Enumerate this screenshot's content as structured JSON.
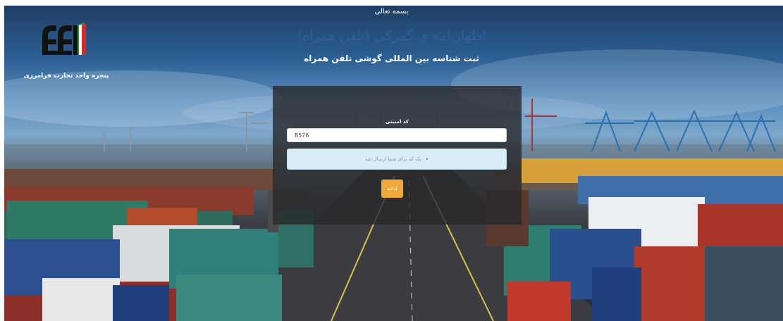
{
  "header": {
    "invocation": "بسمه تعالی",
    "title": "اظهارنامه ی گمرکی (تلفن همراه)",
    "subtitle": "ثبت شناسه بین المللی گوشی تلفن همراه"
  },
  "logo": {
    "icon": "customs-logo-icon",
    "caption": "پنجره واحد تجارت فرامرزی"
  },
  "form": {
    "label": "کد امنیتی",
    "code_value": "8576",
    "info_message": "یک کد برای شما ارسال شد",
    "continue_label": "ادامه"
  },
  "colors": {
    "accent": "#f0a83a",
    "info_bg": "#d9edf7",
    "title": "#2f5f99"
  }
}
